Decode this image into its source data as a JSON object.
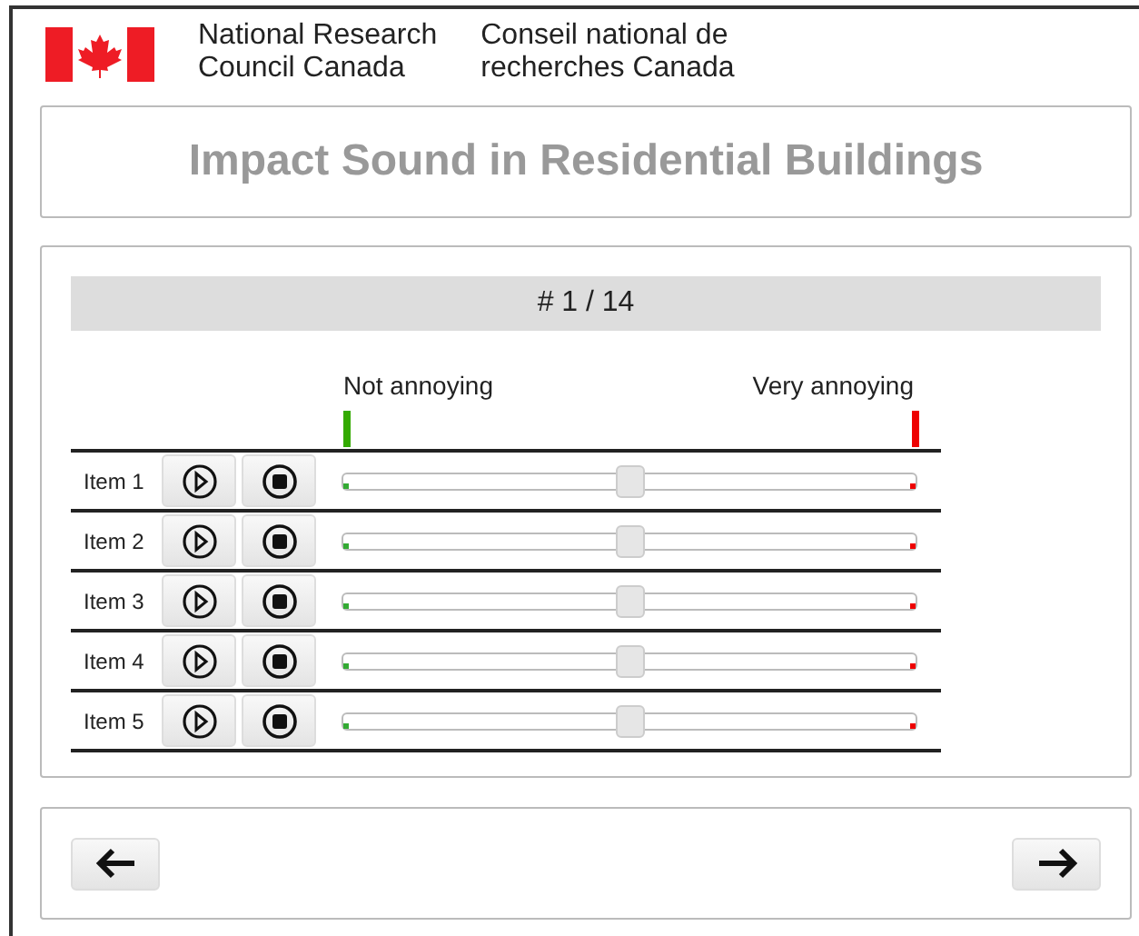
{
  "header": {
    "org_en": [
      "National Research",
      "Council Canada"
    ],
    "org_fr": [
      "Conseil national de",
      "recherches Canada"
    ]
  },
  "title": "Impact Sound in Residential Buildings",
  "progress": "# 1 / 14",
  "scale": {
    "low": "Not annoying",
    "high": "Very annoying"
  },
  "items": [
    {
      "label": "Item 1",
      "level": 0.5
    },
    {
      "label": "Item 2",
      "level": 0.5
    },
    {
      "label": "Item 3",
      "level": 0.5
    },
    {
      "label": "Item 4",
      "level": 0.5
    },
    {
      "label": "Item 5",
      "level": 0.5
    }
  ]
}
